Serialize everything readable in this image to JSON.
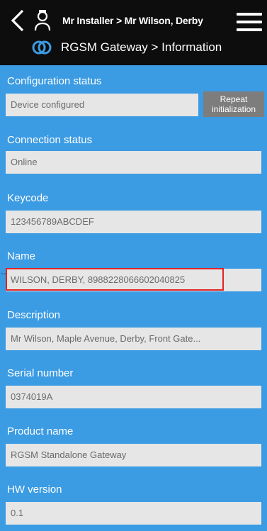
{
  "header": {
    "breadcrumb": "Mr Installer > Mr Wilson, Derby",
    "title": "RGSM Gateway > Information"
  },
  "fields": [
    {
      "label": "Configuration status",
      "value": "Device configured"
    },
    {
      "label": "Connection status",
      "value": "Online"
    },
    {
      "label": "Keycode",
      "value": "123456789ABCDEF"
    },
    {
      "label": "Name",
      "value": "WILSON, DERBY, 8988228066602040825"
    },
    {
      "label": "Description",
      "value": "Mr Wilson, Maple Avenue, Derby, Front Gate..."
    },
    {
      "label": "Serial number",
      "value": "0374019A"
    },
    {
      "label": "Product name",
      "value": "RGSM Standalone Gateway"
    },
    {
      "label": "HW version",
      "value": "0.1"
    }
  ],
  "repeat_button": {
    "line1": "Repeat",
    "line2": "initialization"
  },
  "colors": {
    "header": "#0d0d0d",
    "panel": "#3b9be3",
    "field": "#e6e6e6",
    "highlight": "#e02424",
    "button": "#7d7d7d"
  },
  "icons": [
    "back-chevron-icon",
    "user-icon",
    "hamburger-menu-icon",
    "gateway-link-icon"
  ]
}
